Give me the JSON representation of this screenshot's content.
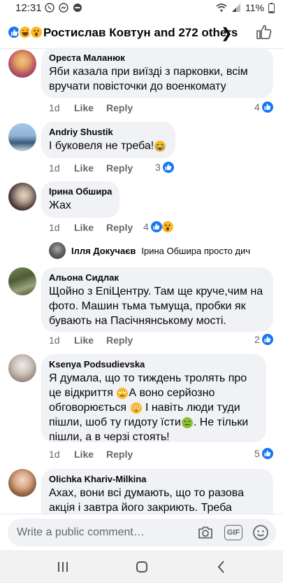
{
  "status": {
    "time": "12:31",
    "battery": "11%"
  },
  "header": {
    "title": "Ростислав Ковтун and 272 others"
  },
  "comments": [
    {
      "name": "Ореста Маланюк",
      "text": "Яби казала при виїзді з парковки, всім вручати повісточки до военкомату",
      "time": "1d",
      "like": "Like",
      "reply": "Reply",
      "count": "4"
    },
    {
      "name": "Andriy Shustik",
      "text": "І буковеля не треба!",
      "time": "1d",
      "like": "Like",
      "reply": "Reply",
      "count": "3"
    },
    {
      "name": "Ірина Обшира",
      "text": "Жах",
      "time": "1d",
      "like": "Like",
      "reply": "Reply",
      "count": "4"
    },
    {
      "name": "Альона Сидлак",
      "text": "Щойно з ЕпіЦентру. Там ще круче,чим на фото. Машин тьма тьмуща, пробки як бувають на Пасічнянському мості.",
      "time": "1d",
      "like": "Like",
      "reply": "Reply",
      "count": "2"
    },
    {
      "name": "Ksenya Podsudievska",
      "text_parts": [
        "Я думала, що то тиждень тролять про це відкриття ",
        "А воно серйозно обговорюється ",
        " І навіть люди туди пішли, шоб ту гидоту їсти",
        ". Не тільки пішли, а в черзі стоять!"
      ],
      "time": "1d",
      "like": "Like",
      "reply": "Reply",
      "count": "5"
    },
    {
      "name": "Olichka Khariv-Milkina",
      "text": "Ахах, вони всі думають, що то разова акція і завтра його закриють. Треба"
    }
  ],
  "subreply": {
    "name": "Ілля Докучаєв",
    "tag": "Ірина Обшира",
    "text": "просто дич"
  },
  "composer": {
    "placeholder": "Write a public comment…",
    "gif_label": "GIF"
  },
  "colors": {
    "like_blue": "#1877f2",
    "bubble_bg": "#f0f2f5",
    "meta_gray": "#65676b"
  },
  "icons": [
    "like-reaction-icon",
    "haha-reaction-icon",
    "wow-reaction-icon",
    "thumbs-up-icon",
    "camera-icon",
    "gif-icon",
    "emoji-icon"
  ]
}
